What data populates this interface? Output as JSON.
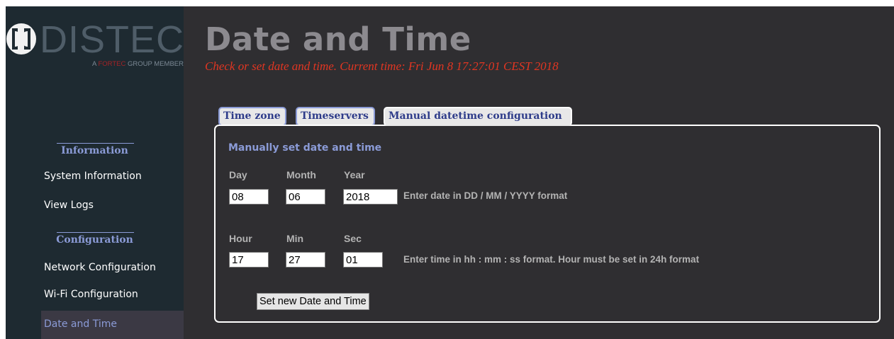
{
  "brand": {
    "name": "DISTEC",
    "tagline_prefix": "A",
    "tagline_accent": "FORTEC",
    "tagline_suffix": "GROUP MEMBER"
  },
  "sidebar": {
    "info_heading": "Information",
    "info_items": [
      {
        "label": "System Information"
      },
      {
        "label": "View Logs"
      }
    ],
    "config_heading": "Configuration",
    "config_items": [
      {
        "label": "Network Configuration"
      },
      {
        "label": "Wi-Fi Configuration"
      },
      {
        "label": "Date and Time",
        "active": true
      }
    ]
  },
  "header": {
    "title": "Date and Time",
    "subtitle": "Check or set date and time. Current time: Fri Jun 8 17:27:01 CEST 2018"
  },
  "tabs": [
    {
      "label": "Time zone"
    },
    {
      "label": "Timeservers"
    },
    {
      "label": "Manual datetime configuration",
      "active": true
    }
  ],
  "form": {
    "heading": "Manually set date and time",
    "date": {
      "day_label": "Day",
      "month_label": "Month",
      "year_label": "Year",
      "day": "08",
      "month": "06",
      "year": "2018",
      "hint": "Enter date in DD / MM / YYYY format"
    },
    "time": {
      "hour_label": "Hour",
      "min_label": "Min",
      "sec_label": "Sec",
      "hour": "17",
      "min": "27",
      "sec": "01",
      "hint": "Enter time in hh : mm : ss format. Hour must be set in 24h format"
    },
    "submit_label": "Set new Date and Time"
  },
  "colors": {
    "sidebar_bg": "#1e2a31",
    "main_bg": "#2f2e31",
    "accent": "#8b9bd7",
    "subtitle_red": "#e23622",
    "title_gray": "#8c8a8f"
  },
  "icons": {
    "logo_mark": "distec-logo-icon"
  }
}
